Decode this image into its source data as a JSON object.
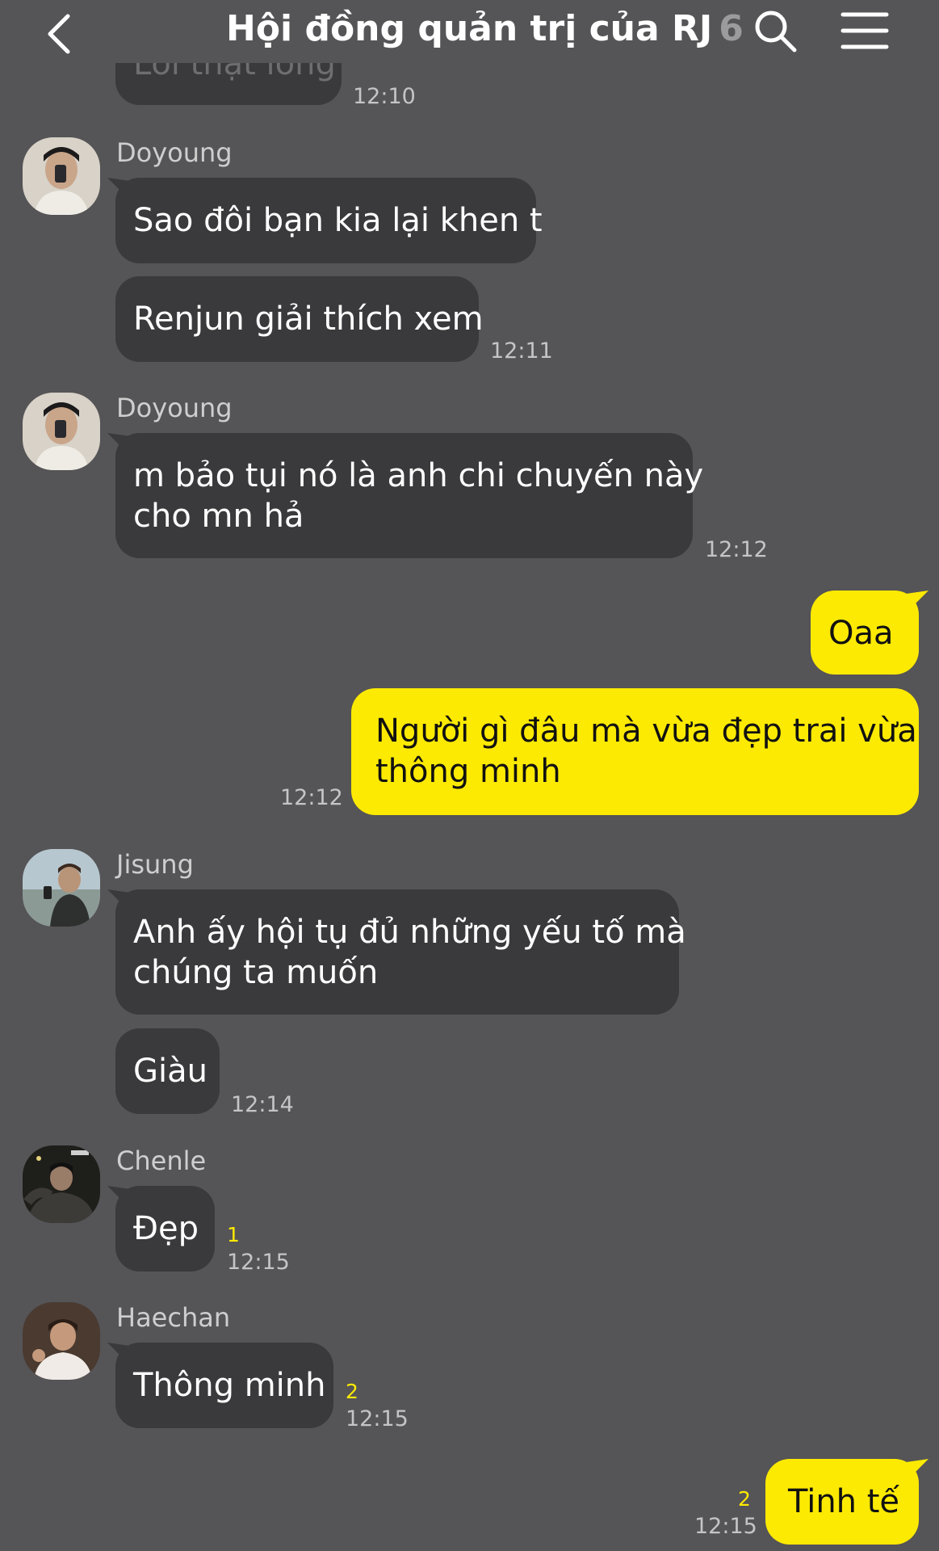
{
  "header": {
    "title": "Hội đồng quản trị của RJ",
    "member_count": "6"
  },
  "top_partial": {
    "text": "Lời thật lòng",
    "time": "12:10"
  },
  "messages": [
    {
      "sender": "Doyoung",
      "texts": [
        "Sao đôi bạn kia lại khen t",
        "Renjun giải thích xem"
      ],
      "time": "12:11"
    },
    {
      "sender": "Doyoung",
      "text_line1": "m bảo tụi nó là anh chi chuyến này",
      "text_line2": "cho mn hả",
      "time": "12:12"
    },
    {
      "mine1": "Oaa",
      "mine2_line1": "Người gì đâu mà vừa đẹp trai vừa",
      "mine2_line2": "thông minh",
      "time": "12:12"
    },
    {
      "sender": "Jisung",
      "text_line1": "Anh ấy hội tụ đủ những yếu tố mà",
      "text_line2": "chúng ta muốn",
      "text2": "Giàu",
      "time": "12:14"
    },
    {
      "sender": "Chenle",
      "text": "Đẹp",
      "unread": "1",
      "time": "12:15"
    },
    {
      "sender": "Haechan",
      "text": "Thông minh",
      "unread": "2",
      "time": "12:15"
    },
    {
      "mine": "Tinh tế",
      "unread": "2",
      "time": "12:15"
    }
  ],
  "colors": {
    "background": "#555456",
    "bubble_other": "#3a393b",
    "bubble_mine": "#fdea02",
    "unread": "#fdea02"
  },
  "icons": [
    "back-arrow-icon",
    "search-icon",
    "menu-icon"
  ]
}
